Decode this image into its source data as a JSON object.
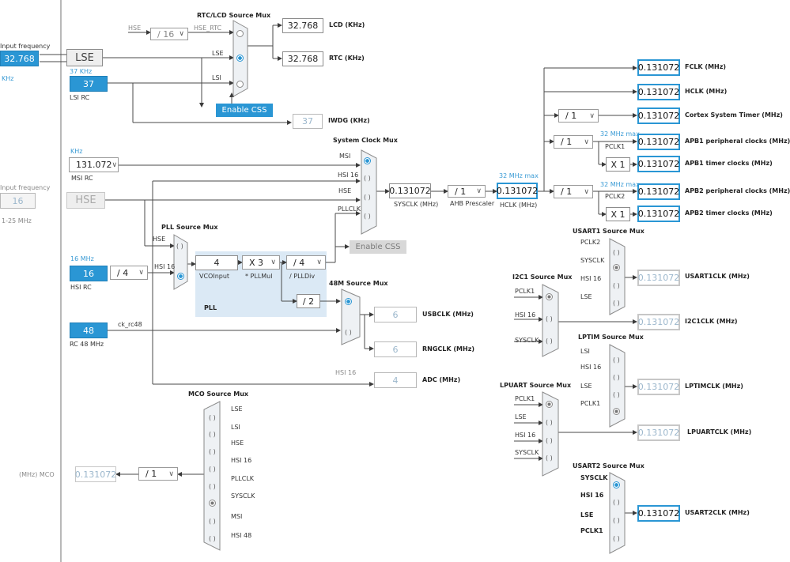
{
  "inputs": {
    "input_frequency_label": "Input frequency",
    "lse_freq": "32.768",
    "khz": "KHz",
    "lse_label": "LSE",
    "lsi_freq_caption": "37 KHz",
    "lsi_value": "37",
    "lsi_label": "LSI RC",
    "msi_caption": "KHz",
    "msi_value": "131.072",
    "msi_label": "MSI RC",
    "hse_input_label": "Input frequency",
    "hse_freq": "16",
    "hse_range": "1-25 MHz",
    "hse_label": "HSE",
    "hsi_caption": "16 MHz",
    "hsi_value": "16",
    "hsi_div": "/ 4",
    "hsi_label": "HSI RC",
    "rc48_value": "48",
    "rc48_label": "RC 48 MHz",
    "ck_rc48": "ck_rc48"
  },
  "rtc": {
    "mux_title": "RTC/LCD Source Mux",
    "hse_label": "HSE",
    "hse_div": "/ 16",
    "hse_rtc": "HSE_RTC",
    "lse": "LSE",
    "lsi": "LSI",
    "lcd_value": "32.768",
    "lcd_label": "LCD (KHz)",
    "rtc_value": "32.768",
    "rtc_label": "RTC (KHz)",
    "enable_css": "Enable CSS",
    "iwdg_value": "37",
    "iwdg_label": "IWDG (KHz)"
  },
  "sysclk": {
    "mux_title": "System Clock Mux",
    "msi": "MSI",
    "hsi16": "HSI 16",
    "hse": "HSE",
    "pllclk": "PLLCLK",
    "value": "0.131072",
    "label": "SYSCLK (MHz)",
    "enable_css": "Enable CSS",
    "ahb_div": "/ 1",
    "ahb_label": "AHB Prescaler",
    "hclk_max": "32 MHz max",
    "hclk_value": "0.131072",
    "hclk_label": "HCLK (MHz)"
  },
  "pll": {
    "mux_title": "PLL Source Mux",
    "hse": "HSE",
    "hsi16": "HSI 16",
    "vco_input": "4",
    "vco_label": "VCOInput",
    "mul": "X 3",
    "mul_label": "* PLLMul",
    "div": "/ 4",
    "div_label": "/ PLLDiv",
    "title": "PLL",
    "div2": "/ 2"
  },
  "m48": {
    "mux_title": "48M Source Mux",
    "usb_value": "6",
    "usb_label": "USBCLK (MHz)",
    "rng_value": "6",
    "rng_label": "RNGCLK (MHz)",
    "hsi16": "HSI 16",
    "adc_value": "4",
    "adc_label": "ADC (MHz)"
  },
  "outputs": {
    "fclk_value": "0.131072",
    "fclk_label": "FCLK (MHz)",
    "hclk_value": "0.131072",
    "hclk_label": "HCLK (MHz)",
    "cortex_div": "/ 1",
    "cortex_value": "0.131072",
    "cortex_label": "Cortex System Timer (MHz)",
    "apb1_max": "32 MHz max",
    "apb1_div": "/ 1",
    "pclk1": "PCLK1",
    "apb1_value": "0.131072",
    "apb1_label": "APB1 peripheral clocks (MHz)",
    "apb1_x": "X 1",
    "apb1_timer_value": "0.131072",
    "apb1_timer_label": "APB1 timer clocks (MHz)",
    "apb2_max": "32 MHz max",
    "apb2_div": "/ 1",
    "pclk2": "PCLK2",
    "apb2_value": "0.131072",
    "apb2_label": "APB2 peripheral clocks (MHz)",
    "apb2_x": "X 1",
    "apb2_timer_value": "0.131072",
    "apb2_timer_label": "APB2 timer clocks (MHz)"
  },
  "usart1": {
    "mux_title": "USART1 Source Mux",
    "inputs": [
      "PCLK2",
      "SYSCLK",
      "HSI 16",
      "LSE"
    ],
    "value": "0.131072",
    "label": "USART1CLK (MHz)"
  },
  "i2c1": {
    "mux_title": "I2C1 Source Mux",
    "inputs": [
      "PCLK1",
      "HSI 16",
      "SYSCLK"
    ],
    "value": "0.131072",
    "label": "I2C1CLK (MHz)"
  },
  "lptim": {
    "mux_title": "LPTIM Source Mux",
    "inputs": [
      "LSI",
      "HSI 16",
      "LSE",
      "PCLK1"
    ],
    "value": "0.131072",
    "label": "LPTIMCLK (MHz)"
  },
  "lpuart": {
    "mux_title": "LPUART Source Mux",
    "inputs": [
      "PCLK1",
      "LSE",
      "HSI 16",
      "SYSCLK"
    ],
    "value": "0.131072",
    "label": "LPUARTCLK (MHz)"
  },
  "usart2": {
    "mux_title": "USART2 Source Mux",
    "inputs": [
      "SYSCLK",
      "HSI 16",
      "LSE",
      "PCLK1"
    ],
    "value": "0.131072",
    "label": "USART2CLK (MHz)"
  },
  "mco": {
    "mux_title": "MCO Source Mux",
    "inputs": [
      "LSE",
      "LSI",
      "HSE",
      "HSI 16",
      "PLLCLK",
      "SYSCLK",
      "MSI",
      "HSI 48"
    ],
    "div": "/ 1",
    "value": "0.131072",
    "label": "(MHz) MCO"
  },
  "colors": {
    "accent": "#2a96d4",
    "line": "#4a4a4a",
    "pll_bg": "#dbe9f5"
  }
}
